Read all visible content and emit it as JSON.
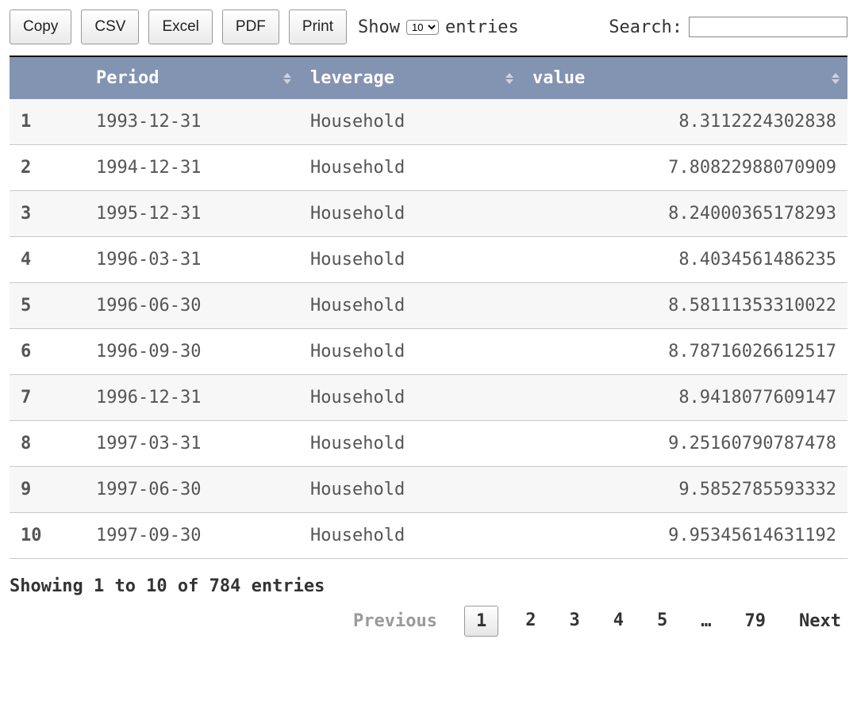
{
  "toolbar": {
    "buttons": {
      "copy": "Copy",
      "csv": "CSV",
      "excel": "Excel",
      "pdf": "PDF",
      "print": "Print"
    },
    "length": {
      "show_label": "Show",
      "entries_label": "entries",
      "selected": "10"
    },
    "search": {
      "label": "Search:",
      "value": ""
    }
  },
  "table": {
    "headers": {
      "index": "",
      "period": "Period",
      "leverage": "leverage",
      "value": "value"
    },
    "rows": [
      {
        "n": "1",
        "period": "1993-12-31",
        "leverage": "Household",
        "value": "8.3112224302838"
      },
      {
        "n": "2",
        "period": "1994-12-31",
        "leverage": "Household",
        "value": "7.80822988070909"
      },
      {
        "n": "3",
        "period": "1995-12-31",
        "leverage": "Household",
        "value": "8.24000365178293"
      },
      {
        "n": "4",
        "period": "1996-03-31",
        "leverage": "Household",
        "value": "8.4034561486235"
      },
      {
        "n": "5",
        "period": "1996-06-30",
        "leverage": "Household",
        "value": "8.58111353310022"
      },
      {
        "n": "6",
        "period": "1996-09-30",
        "leverage": "Household",
        "value": "8.78716026612517"
      },
      {
        "n": "7",
        "period": "1996-12-31",
        "leverage": "Household",
        "value": "8.9418077609147"
      },
      {
        "n": "8",
        "period": "1997-03-31",
        "leverage": "Household",
        "value": "9.25160790787478"
      },
      {
        "n": "9",
        "period": "1997-06-30",
        "leverage": "Household",
        "value": "9.5852785593332"
      },
      {
        "n": "10",
        "period": "1997-09-30",
        "leverage": "Household",
        "value": "9.95345614631192"
      }
    ]
  },
  "footer": {
    "info": "Showing 1 to 10 of 784 entries",
    "paginate": {
      "previous": "Previous",
      "next": "Next",
      "ellipsis": "…",
      "pages": [
        "1",
        "2",
        "3",
        "4",
        "5"
      ],
      "last": "79",
      "current": "1"
    }
  }
}
